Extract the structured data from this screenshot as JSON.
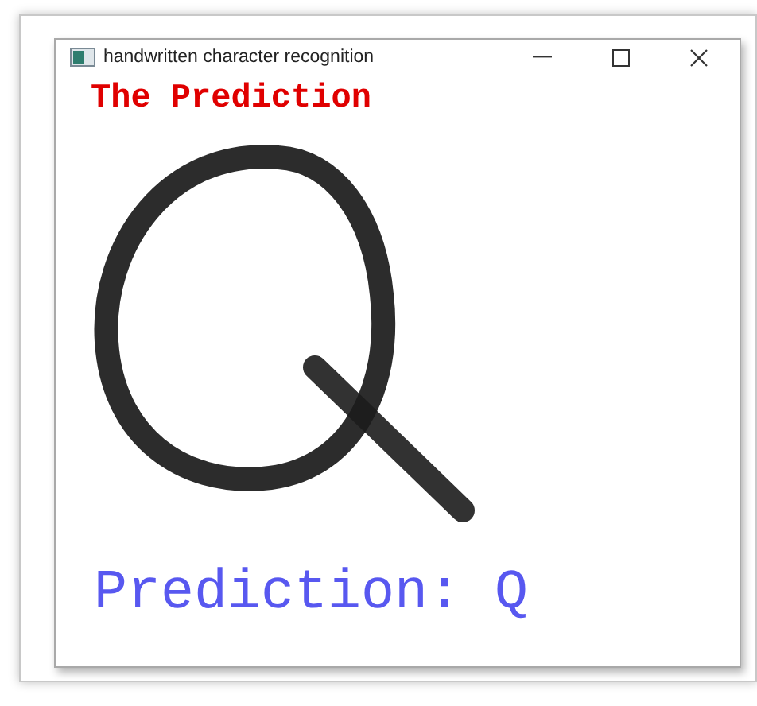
{
  "window": {
    "title": "handwritten character recognition"
  },
  "canvas": {
    "heading": "The Prediction",
    "prediction": "Prediction: Q"
  }
}
